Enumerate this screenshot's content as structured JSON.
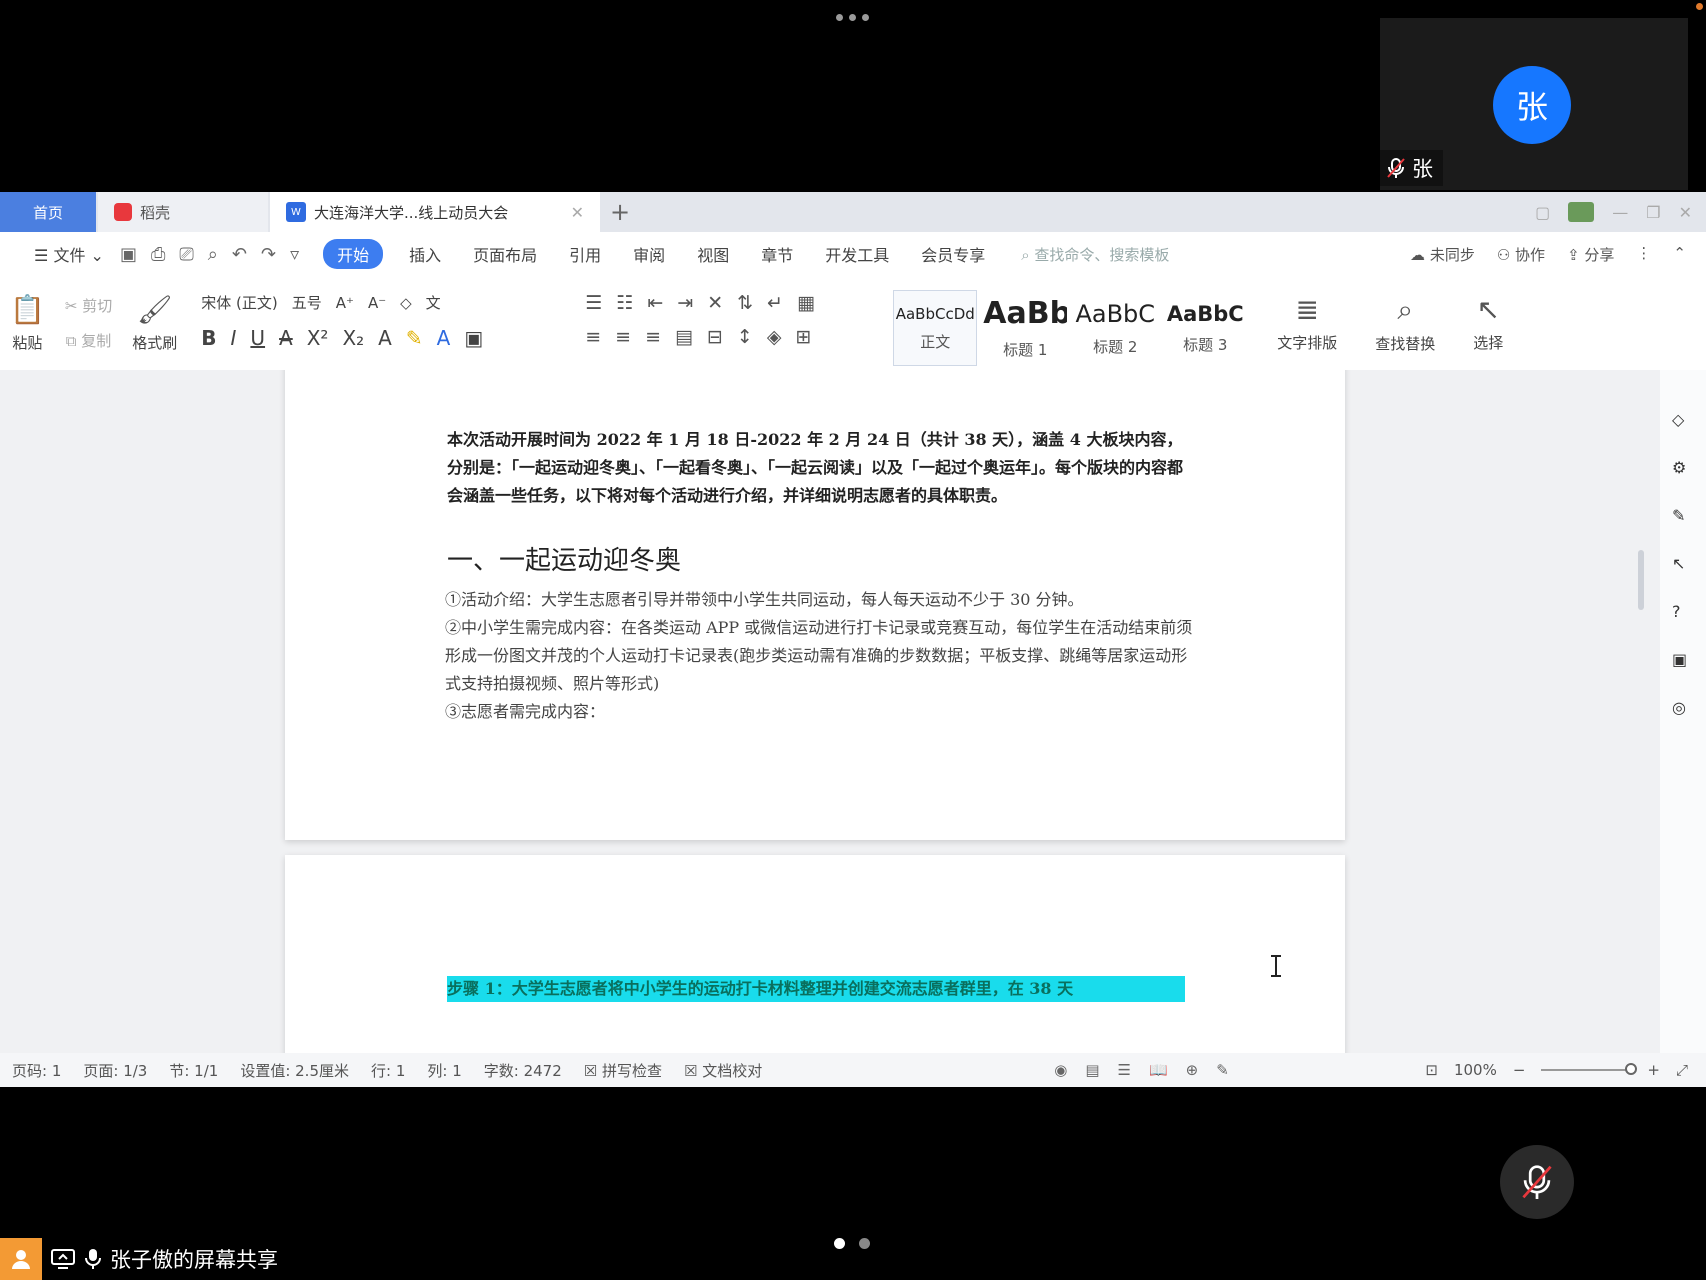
{
  "participant": {
    "avatar_initial": "张",
    "name": "张"
  },
  "tabs": {
    "home": "首页",
    "daoke": "稻壳",
    "doc": "大连海洋大学...线上动员大会"
  },
  "menu": {
    "file": "文件",
    "items": [
      "开始",
      "插入",
      "页面布局",
      "引用",
      "审阅",
      "视图",
      "章节",
      "开发工具",
      "会员专享"
    ],
    "active": "开始",
    "search": "查找命令、搜索模板",
    "sync": "未同步",
    "collab": "协作",
    "share": "分享"
  },
  "ribbon": {
    "paste": "粘贴",
    "cut": "剪切",
    "copy": "复制",
    "format_painter": "格式刷",
    "font_name": "宋体 (正文)",
    "font_size": "五号",
    "styles": [
      {
        "sample": "AaBbCcDd",
        "label": "正文"
      },
      {
        "sample": "AaBb",
        "label": "标题 1"
      },
      {
        "sample": "AaBbC",
        "label": "标题 2"
      },
      {
        "sample": "AaBbC",
        "label": "标题 3"
      }
    ],
    "text_layout": "文字排版",
    "find_replace": "查找替换",
    "select": "选择"
  },
  "document": {
    "intro": "本次活动开展时间为 2022 年 1 月 18 日-2022 年 2 月 24 日（共计 38 天），涵盖 4 大板块内容，分别是：「一起运动迎冬奥」、「一起看冬奥」、「一起云阅读」以及「一起过个奥运年」。每个版块的内容都会涵盖一些任务，以下将对每个活动进行介绍，并详细说明志愿者的具体职责。",
    "heading": "一、一起运动迎冬奥",
    "item1": "①活动介绍：大学生志愿者引导并带领中小学生共同运动，每人每天运动不少于 30 分钟。",
    "item2": "②中小学生需完成内容：在各类运动 APP 或微信运动进行打卡记录或竞赛互动，每位学生在活动结束前须形成一份图文并茂的个人运动打卡记录表(跑步类运动需有准确的步数数据；平板支撑、跳绳等居家运动形式支持拍摄视频、照片等形式)",
    "item3": "③志愿者需完成内容：",
    "page2_highlight": "步骤 1：大学生志愿者将中小学生的运动打卡材料整理并创建交流志愿者群里，在 38 天"
  },
  "status": {
    "page_num": "页码: 1",
    "pages": "页面: 1/3",
    "section": "节: 1/1",
    "setting": "设置值: 2.5厘米",
    "row": "行: 1",
    "col": "列: 1",
    "words": "字数: 2472",
    "spell": "拼写检查",
    "proofread": "文档校对",
    "zoom": "100%"
  },
  "share": {
    "label": "张子傲的屏幕共享"
  },
  "colors": {
    "accent": "#1677ff",
    "highlight": "#19dcec",
    "tab_home": "#4b7fe0",
    "share_icon": "#f39a34"
  },
  "pager": {
    "count": 2,
    "active": 1
  }
}
